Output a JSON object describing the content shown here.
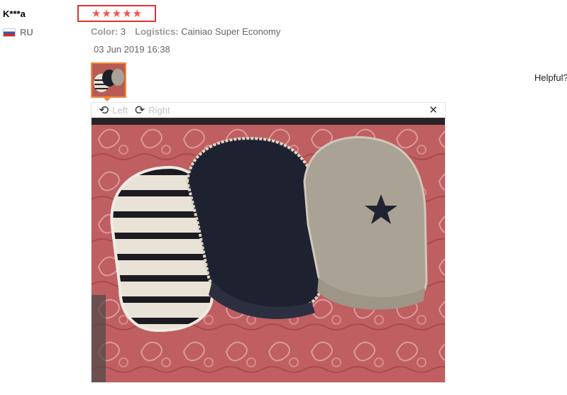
{
  "review": {
    "username": "K***a",
    "country_code": "RU",
    "rating_stars": 5,
    "star_glyph": "★",
    "color_label": "Color:",
    "color_value": "3",
    "logistics_label": "Logistics:",
    "logistics_value": "Cainiao Super Economy",
    "date": "03 Jun 2019 16:38",
    "helpful_label": "Helpful?"
  },
  "viewer": {
    "rotate_left_label": "Left",
    "rotate_right_label": "Right",
    "rotate_left_icon": "⟲",
    "rotate_right_icon": "⟳",
    "close_icon": "✕"
  },
  "colors": {
    "star": "#f0544a",
    "highlight_border": "#e0332f",
    "thumb_border": "#f08a3e"
  }
}
